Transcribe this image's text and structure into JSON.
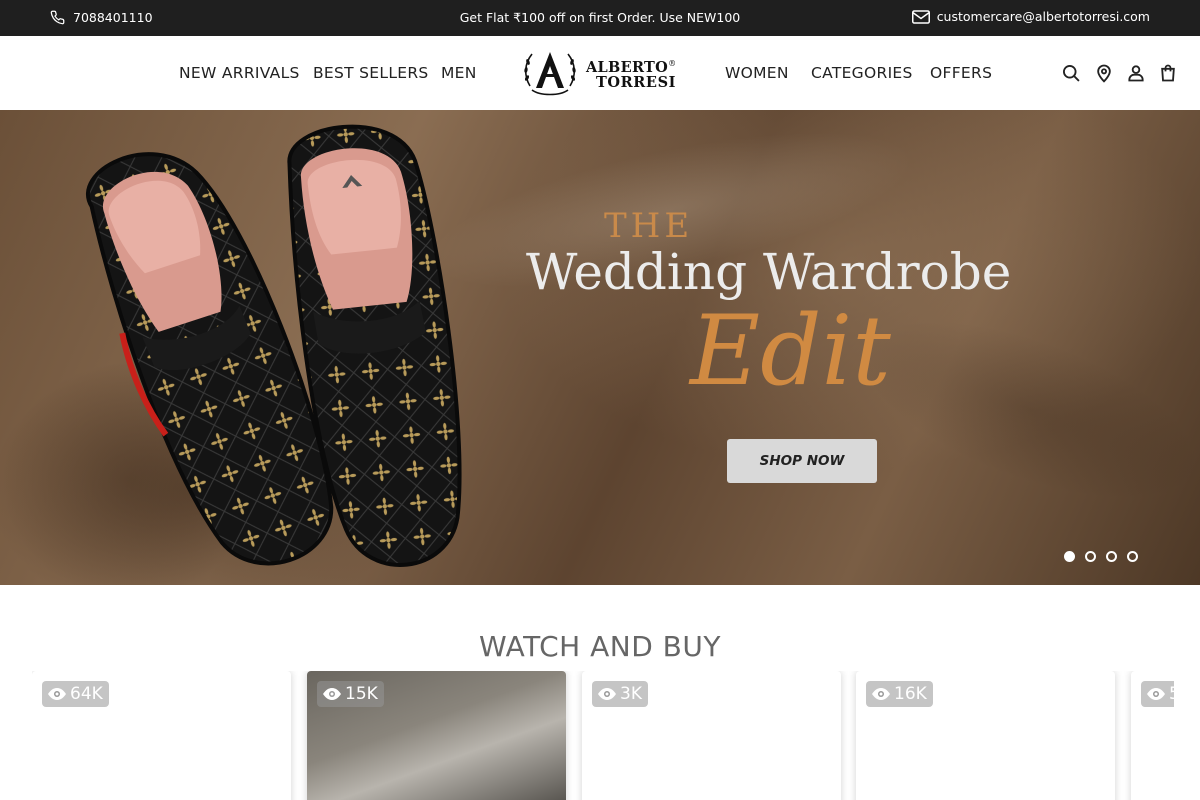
{
  "topbar": {
    "phone": "7088401110",
    "promo": "Get Flat ₹100 off on first Order. Use NEW100",
    "email": "customercare@albertotorresi.com",
    "icons": [
      "phone-icon",
      "mail-icon"
    ]
  },
  "nav": {
    "left": [
      "NEW ARRIVALS",
      "BEST SELLERS",
      "MEN"
    ],
    "right": [
      "WOMEN",
      "CATEGORIES",
      "OFFERS"
    ]
  },
  "logo": {
    "line1": "ALBERTO",
    "line2": "TORRESI",
    "reg": "®"
  },
  "header_icons": [
    "search-icon",
    "location-pin-icon",
    "user-icon",
    "cart-icon"
  ],
  "hero": {
    "the": "THE",
    "title": "Wedding Wardrobe",
    "script": "Edit",
    "cta": "SHOP NOW",
    "slides": 4,
    "active_slide": 1
  },
  "watch": {
    "title": "WATCH AND BUY",
    "cards": [
      {
        "views": "64K"
      },
      {
        "views": "15K"
      },
      {
        "views": "3K"
      },
      {
        "views": "16K"
      },
      {
        "views": "5"
      }
    ]
  },
  "colors": {
    "topbar_bg": "#1f1f1f",
    "hero_accent": "#c98a4a",
    "button_bg": "#d9d9d9"
  }
}
